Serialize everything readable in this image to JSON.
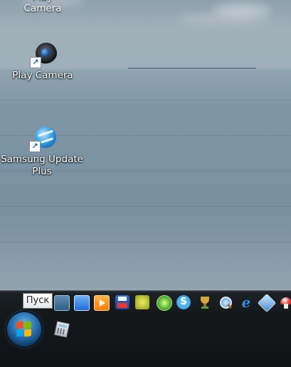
{
  "desktop": {
    "icons": [
      {
        "label": "Play Camera",
        "icon": "camera-icon"
      },
      {
        "label": "Samsung Update Plus",
        "label_lines": [
          "Samsung Update",
          "Plus"
        ],
        "icon": "globe-update-icon"
      }
    ],
    "top_partial_label": "Play Camera"
  },
  "taskbar": {
    "start_tooltip": "Пуск",
    "start_icon": "windows-orb-icon",
    "quick_launch": [
      "photo-viewer-icon",
      "desktop-icon",
      "media-player-icon",
      "save-icon",
      "robot-icon",
      "antivirus-icon",
      "skype-icon",
      "trophy-icon",
      "globe-search-icon",
      "ie-icon",
      "network-icon",
      "mushroom-icon"
    ],
    "pinned": [
      "calculator-icon"
    ]
  },
  "colors": {
    "accent": "#2b78b9",
    "taskbar": "#15191c"
  }
}
